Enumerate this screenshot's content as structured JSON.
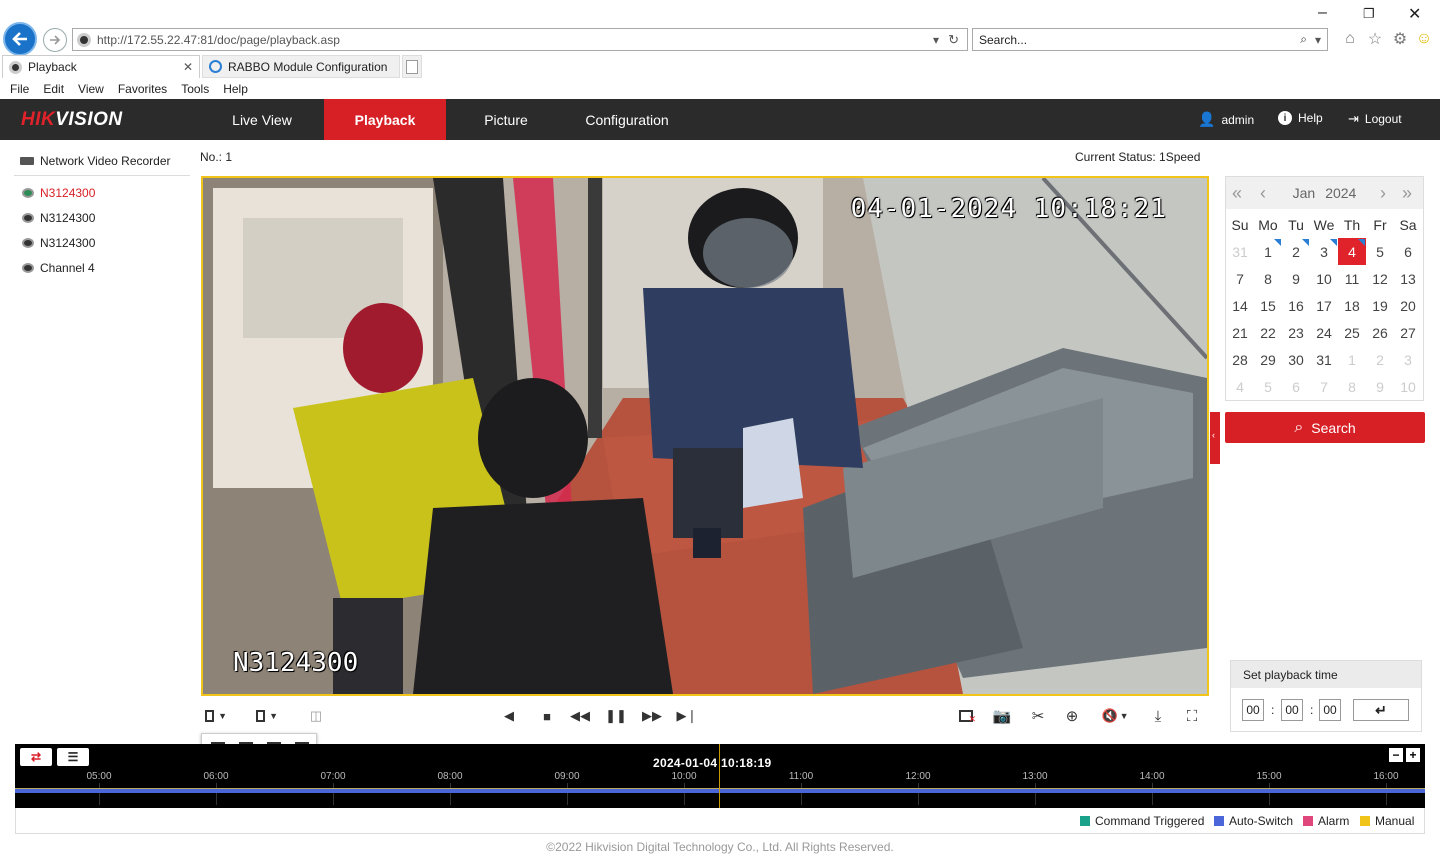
{
  "browser": {
    "url_host": "http://172.55.22.47",
    "url_rest": ":81/doc/page/playback.asp",
    "search_placeholder": "Search...",
    "tabs": [
      {
        "label": "Playback"
      },
      {
        "label": "RABBO Module Configuration"
      }
    ],
    "menu": [
      "File",
      "Edit",
      "View",
      "Favorites",
      "Tools",
      "Help"
    ]
  },
  "app": {
    "logo_a": "HIK",
    "logo_b": "VISION",
    "nav": [
      "Live View",
      "Playback",
      "Picture",
      "Configuration"
    ],
    "active_nav": "Playback",
    "user": "admin",
    "help": "Help",
    "logout": "Logout"
  },
  "tree": {
    "title": "Network Video Recorder",
    "items": [
      "N3124300",
      "N3124300",
      "N3124300",
      "Channel 4"
    ]
  },
  "video": {
    "no_label": "No.: 1",
    "status": "Current Status: 1Speed",
    "osd_time": "04-01-2024 10:18:21",
    "osd_name": "N3124300"
  },
  "calendar": {
    "month": "Jan",
    "year": "2024",
    "weekdays": [
      "Su",
      "Mo",
      "Tu",
      "We",
      "Th",
      "Fr",
      "Sa"
    ],
    "selected_day": "4",
    "record_days": [
      "1",
      "2",
      "3",
      "4"
    ],
    "weeks": [
      [
        "31",
        "1",
        "2",
        "3",
        "4",
        "5",
        "6"
      ],
      [
        "7",
        "8",
        "9",
        "10",
        "11",
        "12",
        "13"
      ],
      [
        "14",
        "15",
        "16",
        "17",
        "18",
        "19",
        "20"
      ],
      [
        "21",
        "22",
        "23",
        "24",
        "25",
        "26",
        "27"
      ],
      [
        "28",
        "29",
        "30",
        "31",
        "1",
        "2",
        "3"
      ],
      [
        "4",
        "5",
        "6",
        "7",
        "8",
        "9",
        "10"
      ]
    ]
  },
  "search_label": "Search",
  "playback_time": {
    "title": "Set playback time",
    "hh": "00",
    "mm": "00",
    "ss": "00"
  },
  "timeline": {
    "current": "2024-01-04 10:18:19",
    "ticks": [
      "05:00",
      "06:00",
      "07:00",
      "08:00",
      "09:00",
      "10:00",
      "11:00",
      "12:00",
      "13:00",
      "14:00",
      "15:00",
      "16:00"
    ]
  },
  "legend": [
    {
      "label": "Command Triggered",
      "color": "#1aa38a"
    },
    {
      "label": "Auto-Switch",
      "color": "#4a66d9"
    },
    {
      "label": "Alarm",
      "color": "#e0457b"
    },
    {
      "label": "Manual",
      "color": "#f0c419"
    }
  ],
  "colors": {
    "accent": "#d71f26",
    "record": "#4a66d9",
    "border_active": "#f0c419"
  },
  "footer": "©2022 Hikvision Digital Technology Co., Ltd. All Rights Reserved."
}
